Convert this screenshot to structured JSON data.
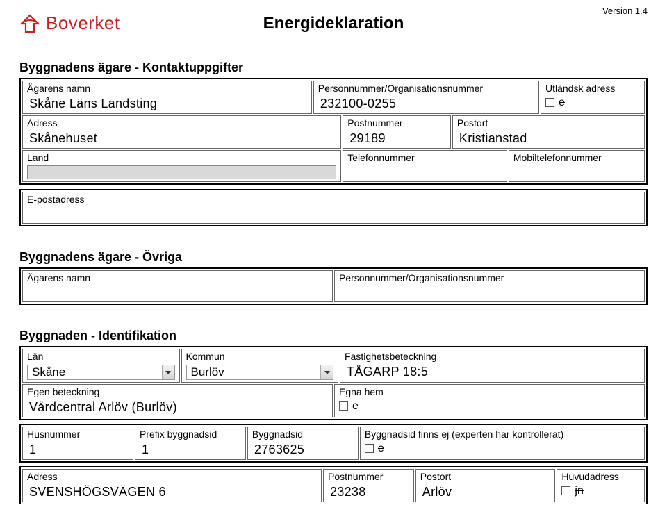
{
  "header": {
    "logo_text": "Boverket",
    "title": "Energideklaration",
    "version": "Version 1.4"
  },
  "owner_contact": {
    "heading": "Byggnadens ägare - Kontaktuppgifter",
    "labels": {
      "name": "Ägarens namn",
      "orgnr": "Personnummer/Organisationsnummer",
      "foreign": "Utländsk adress",
      "address": "Adress",
      "postnr": "Postnummer",
      "postort": "Postort",
      "country": "Land",
      "phone": "Telefonnummer",
      "mobile": "Mobiltelefonnummer",
      "email": "E-postadress"
    },
    "values": {
      "name": "Skåne Läns Landsting",
      "orgnr": "232100-0255",
      "foreign_mark": "e",
      "address": "Skånehuset",
      "postnr": "29189",
      "postort": "Kristianstad"
    }
  },
  "owner_other": {
    "heading": "Byggnadens ägare - Övriga",
    "labels": {
      "name": "Ägarens namn",
      "orgnr": "Personnummer/Organisationsnummer"
    }
  },
  "ident": {
    "heading": "Byggnaden - Identifikation",
    "labels": {
      "lan": "Län",
      "kommun": "Kommun",
      "fastighet": "Fastighetsbeteckning",
      "egen": "Egen beteckning",
      "egnahem": "Egna hem",
      "husnr": "Husnummer",
      "prefix": "Prefix byggnadsid",
      "byggnadsid": "Byggnadsid",
      "missing": "Byggnadsid finns ej (experten har kontrollerat)",
      "address": "Adress",
      "postnr": "Postnummer",
      "postort": "Postort",
      "huvud": "Huvudadress"
    },
    "values": {
      "lan": "Skåne",
      "kommun": "Burlöv",
      "fastighet": "TÅGARP 18:5",
      "egen": "Vårdcentral Arlöv (Burlöv)",
      "egnahem_mark": "e",
      "husnr": "1",
      "prefix": "1",
      "byggnadsid": "2763625",
      "missing_mark": "e",
      "address": "SVENSHÖGSVÄGEN 6",
      "postnr": "23238",
      "postort": "Arlöv",
      "huvud_mark": "jn"
    }
  }
}
